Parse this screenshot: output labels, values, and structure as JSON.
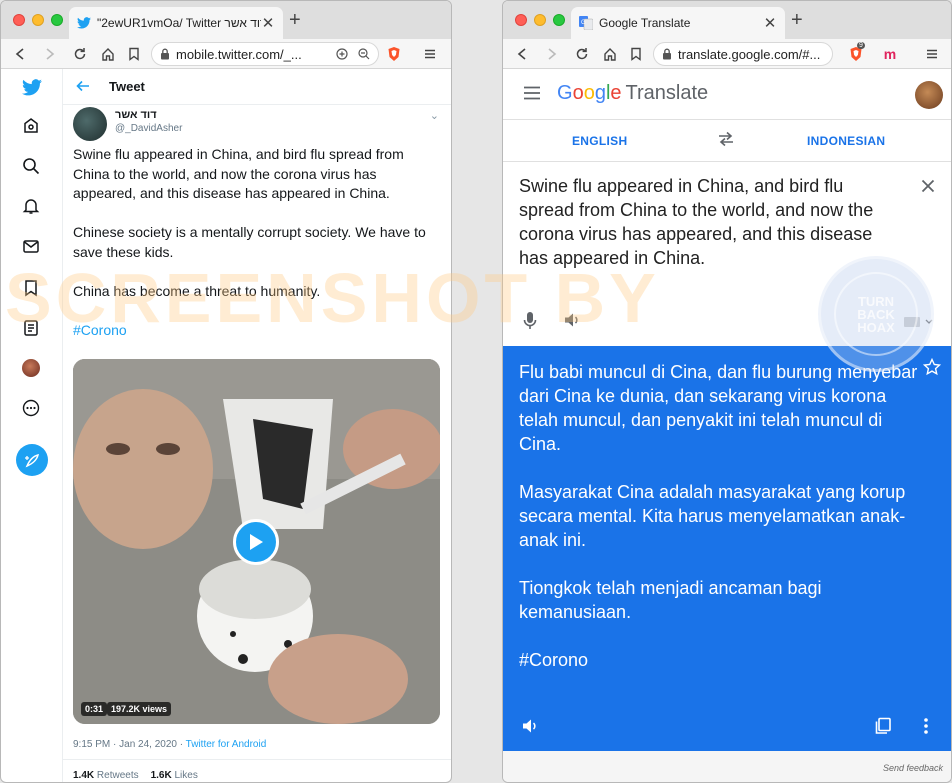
{
  "left_window": {
    "tab_title": "\"2ewUR1vmOa/ Twitter דוד אשר\"",
    "url": "mobile.twitter.com/_...",
    "header_title": "Tweet",
    "author_name": "דוד אשר",
    "author_handle": "@_DavidAsher",
    "tweet_paragraphs": [
      "Swine flu appeared in China, and bird flu spread from China to the world, and now the corona virus has appeared, and this disease has appeared in China.",
      "Chinese society is a mentally corrupt society. We have to save these kids.",
      "China has become a threat to humanity."
    ],
    "hashtag": "#Corono",
    "video_duration": "0:31",
    "video_views": "197.2K views",
    "timestamp": "9:15 PM · Jan 24, 2020 · ",
    "source": "Twitter for Android",
    "retweets_count": "1.4K",
    "retweets_label": "Retweets",
    "likes_count": "1.6K",
    "likes_label": "Likes"
  },
  "right_window": {
    "tab_title": "Google Translate",
    "url": "translate.google.com/#...",
    "shield_badge": "9",
    "extension_label": "m",
    "logo_letters": [
      "G",
      "o",
      "o",
      "g",
      "l",
      "e"
    ],
    "logo_product": "Translate",
    "source_lang": "ENGLISH",
    "target_lang": "INDONESIAN",
    "source_text": "Swine flu appeared in China, and bird flu spread from China to the world, and now the corona virus has appeared, and this disease has appeared in China.",
    "translation_paragraphs": [
      "Flu babi muncul di Cina, dan flu burung menyebar dari Cina ke dunia, dan sekarang virus korona telah muncul, dan penyakit ini telah muncul di Cina.",
      "Masyarakat Cina adalah masyarakat yang korup secara mental. Kita harus menyelamatkan anak-anak ini.",
      "Tiongkok telah menjadi ancaman bagi kemanusiaan.",
      "#Corono"
    ],
    "send_feedback": "Send feedback"
  },
  "watermark": {
    "text": "SCREENSHOT BY",
    "seal_lines": [
      "TURN",
      "BACK",
      "HOAX"
    ],
    "seal_ring": "MASYARAKAT ANTIFITNAH INDONESIA"
  },
  "colors": {
    "twitter_blue": "#1da1f2",
    "translate_blue": "#1a73e8"
  }
}
